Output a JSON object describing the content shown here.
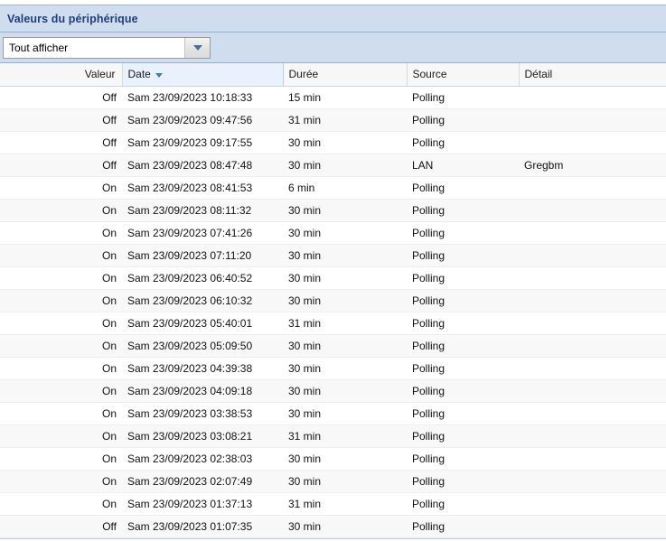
{
  "panel": {
    "title": "Valeurs du périphérique"
  },
  "toolbar": {
    "filter": {
      "selected": "Tout afficher",
      "placeholder": "Tout afficher",
      "dropdown_icon": "chevron-down-icon"
    }
  },
  "grid": {
    "sort": {
      "column": "Date",
      "direction": "descending",
      "icon": "sort-descending-arrow-icon"
    },
    "columns": [
      {
        "key": "valeur",
        "label": "Valeur",
        "align": "right"
      },
      {
        "key": "date",
        "label": "Date",
        "align": "left",
        "sorted": true
      },
      {
        "key": "duree",
        "label": "Durée",
        "align": "left"
      },
      {
        "key": "source",
        "label": "Source",
        "align": "left"
      },
      {
        "key": "detail",
        "label": "Détail",
        "align": "left"
      }
    ],
    "rows": [
      {
        "valeur": "Off",
        "date": "Sam 23/09/2023 10:18:33",
        "duree": "15 min",
        "source": "Polling",
        "detail": ""
      },
      {
        "valeur": "Off",
        "date": "Sam 23/09/2023 09:47:56",
        "duree": "31 min",
        "source": "Polling",
        "detail": ""
      },
      {
        "valeur": "Off",
        "date": "Sam 23/09/2023 09:17:55",
        "duree": "30 min",
        "source": "Polling",
        "detail": ""
      },
      {
        "valeur": "Off",
        "date": "Sam 23/09/2023 08:47:48",
        "duree": "30 min",
        "source": "LAN",
        "detail": "Gregbm"
      },
      {
        "valeur": "On",
        "date": "Sam 23/09/2023 08:41:53",
        "duree": "6 min",
        "source": "Polling",
        "detail": ""
      },
      {
        "valeur": "On",
        "date": "Sam 23/09/2023 08:11:32",
        "duree": "30 min",
        "source": "Polling",
        "detail": ""
      },
      {
        "valeur": "On",
        "date": "Sam 23/09/2023 07:41:26",
        "duree": "30 min",
        "source": "Polling",
        "detail": ""
      },
      {
        "valeur": "On",
        "date": "Sam 23/09/2023 07:11:20",
        "duree": "30 min",
        "source": "Polling",
        "detail": ""
      },
      {
        "valeur": "On",
        "date": "Sam 23/09/2023 06:40:52",
        "duree": "30 min",
        "source": "Polling",
        "detail": ""
      },
      {
        "valeur": "On",
        "date": "Sam 23/09/2023 06:10:32",
        "duree": "30 min",
        "source": "Polling",
        "detail": ""
      },
      {
        "valeur": "On",
        "date": "Sam 23/09/2023 05:40:01",
        "duree": "31 min",
        "source": "Polling",
        "detail": ""
      },
      {
        "valeur": "On",
        "date": "Sam 23/09/2023 05:09:50",
        "duree": "30 min",
        "source": "Polling",
        "detail": ""
      },
      {
        "valeur": "On",
        "date": "Sam 23/09/2023 04:39:38",
        "duree": "30 min",
        "source": "Polling",
        "detail": ""
      },
      {
        "valeur": "On",
        "date": "Sam 23/09/2023 04:09:18",
        "duree": "30 min",
        "source": "Polling",
        "detail": ""
      },
      {
        "valeur": "On",
        "date": "Sam 23/09/2023 03:38:53",
        "duree": "30 min",
        "source": "Polling",
        "detail": ""
      },
      {
        "valeur": "On",
        "date": "Sam 23/09/2023 03:08:21",
        "duree": "31 min",
        "source": "Polling",
        "detail": ""
      },
      {
        "valeur": "On",
        "date": "Sam 23/09/2023 02:38:03",
        "duree": "30 min",
        "source": "Polling",
        "detail": ""
      },
      {
        "valeur": "On",
        "date": "Sam 23/09/2023 02:07:49",
        "duree": "30 min",
        "source": "Polling",
        "detail": ""
      },
      {
        "valeur": "On",
        "date": "Sam 23/09/2023 01:37:13",
        "duree": "31 min",
        "source": "Polling",
        "detail": ""
      },
      {
        "valeur": "Off",
        "date": "Sam 23/09/2023 01:07:35",
        "duree": "30 min",
        "source": "Polling",
        "detail": ""
      }
    ]
  },
  "colors": {
    "header_bg": "#cfddee",
    "header_text": "#1f3f7a",
    "sorted_col_bg": "#e8f1fc",
    "row_alt_bg": "#f8f8f8",
    "accent": "#4a7bb0"
  }
}
